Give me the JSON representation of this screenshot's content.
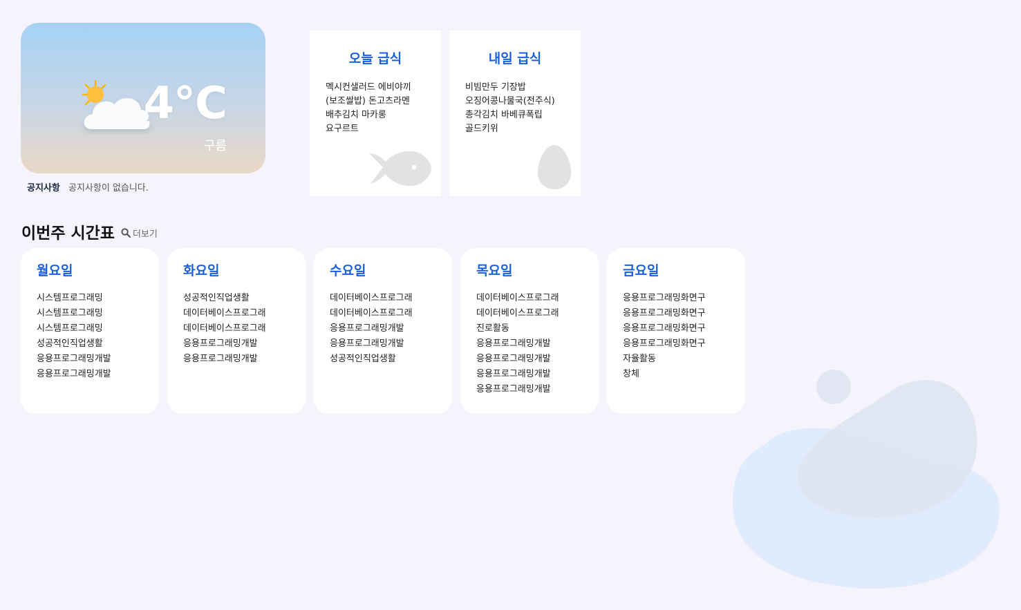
{
  "weather": {
    "temperature": "4°C",
    "condition": "구름",
    "icon": "partly-cloudy-icon"
  },
  "notice": {
    "label": "공지사항",
    "text": "공지사항이 없습니다."
  },
  "meals": [
    {
      "title": "오늘 급식",
      "items": [
        "멕시컨샐러드 에비야끼",
        "(보조쌀밥) 돈고츠라멘",
        "배추김치 마카롱",
        "요구르트"
      ],
      "icon": "fish-icon"
    },
    {
      "title": "내일 급식",
      "items": [
        "비빔만두 기장밥",
        "오징어콩나물국(전주식)",
        "총각김치 바베큐폭립",
        "골드키위"
      ],
      "icon": "egg-icon"
    }
  ],
  "timetable": {
    "title": "이번주 시간표",
    "more_label": "더보기",
    "days": [
      {
        "name": "월요일",
        "subjects": [
          "시스템프로그래밍",
          "시스템프로그래밍",
          "시스템프로그래밍",
          "성공적인직업생활",
          "응용프로그래밍개발",
          "응용프로그래밍개발"
        ]
      },
      {
        "name": "화요일",
        "subjects": [
          "성공적인직업생활",
          "데이터베이스프로그래",
          "데이터베이스프로그래",
          "응용프로그래밍개발",
          "응용프로그래밍개발"
        ]
      },
      {
        "name": "수요일",
        "subjects": [
          "데이터베이스프로그래",
          "데이터베이스프로그래",
          "응용프로그래밍개발",
          "응용프로그래밍개발",
          "성공적인직업생활"
        ]
      },
      {
        "name": "목요일",
        "subjects": [
          "데이터베이스프로그래",
          "데이터베이스프로그래",
          "진로활동",
          "응용프로그래밍개발",
          "응용프로그래밍개발",
          "응용프로그래밍개발",
          "응용프로그래밍개발"
        ]
      },
      {
        "name": "금요일",
        "subjects": [
          "응용프로그래밍화면구",
          "응용프로그래밍화면구",
          "응용프로그래밍화면구",
          "응용프로그래밍화면구",
          "자율활동",
          "창체"
        ]
      }
    ]
  },
  "colors": {
    "accent": "#1a5fe0",
    "background": "#f5f4fc",
    "card": "#ffffff"
  }
}
